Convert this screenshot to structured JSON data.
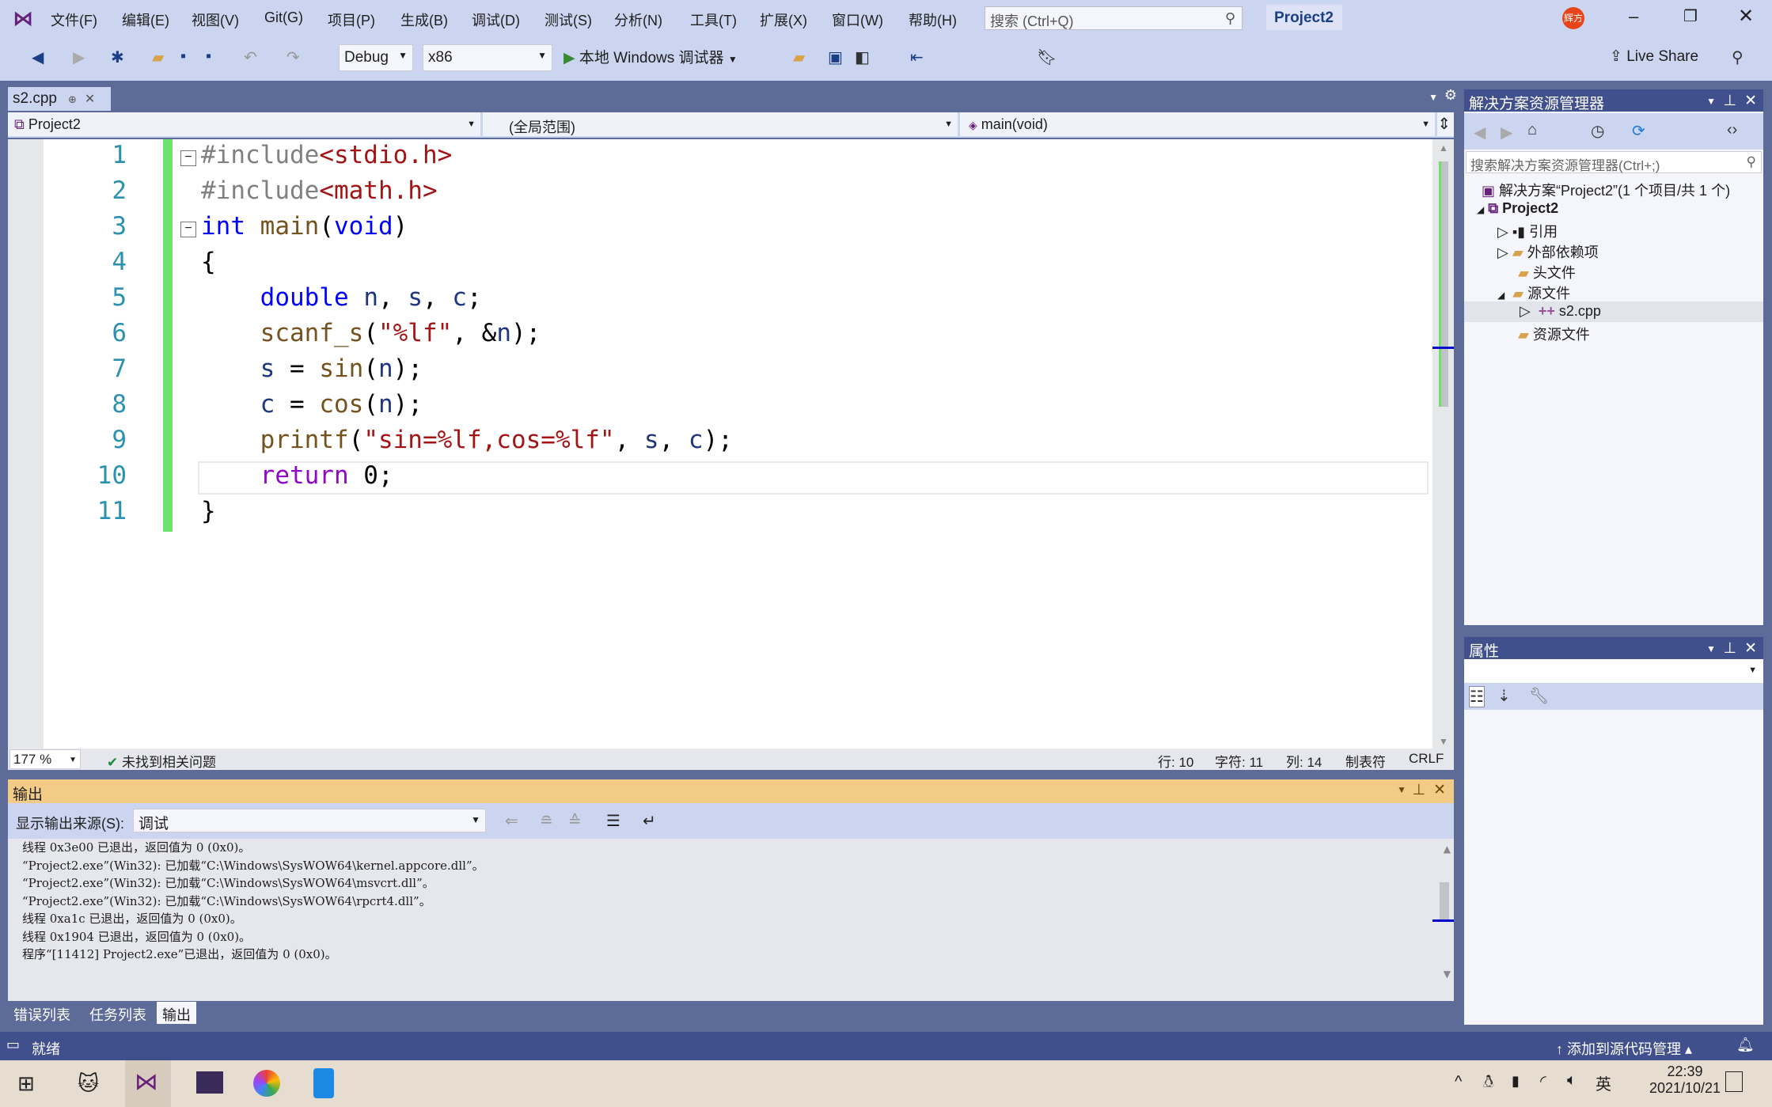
{
  "titlebar": {
    "menus": [
      "文件(F)",
      "编辑(E)",
      "视图(V)",
      "Git(G)",
      "项目(P)",
      "生成(B)",
      "调试(D)",
      "测试(S)",
      "分析(N)",
      "工具(T)",
      "扩展(X)",
      "窗口(W)",
      "帮助(H)"
    ],
    "search_placeholder": "搜索 (Ctrl+Q)",
    "project": "Project2",
    "avatar": "辉方",
    "accent": "#68217a"
  },
  "toolbar": {
    "config": "Debug",
    "platform": "x86",
    "run": "本地 Windows 调试器",
    "live_share": "Live Share"
  },
  "editor": {
    "tab": "s2.cpp",
    "nav_project": "Project2",
    "nav_scope": "(全局范围)",
    "nav_member": "main(void)",
    "lines": [
      [
        [
          "#include",
          "pp"
        ],
        [
          "<stdio.h>",
          "str"
        ]
      ],
      [
        [
          "#include",
          "pp"
        ],
        [
          "<math.h>",
          "str"
        ]
      ],
      [
        [
          "int",
          "kw"
        ],
        [
          " ",
          ""
        ],
        [
          "main",
          "fn"
        ],
        [
          "(",
          ""
        ],
        [
          "void",
          "kw"
        ],
        [
          ")",
          ""
        ]
      ],
      [
        [
          "{",
          ""
        ]
      ],
      [
        [
          "    ",
          ""
        ],
        [
          "double",
          "kw"
        ],
        [
          " ",
          ""
        ],
        [
          "n",
          "var"
        ],
        [
          ", ",
          ""
        ],
        [
          "s",
          "var"
        ],
        [
          ", ",
          ""
        ],
        [
          "c",
          "var"
        ],
        [
          ";",
          ""
        ]
      ],
      [
        [
          "    ",
          ""
        ],
        [
          "scanf_s",
          "fn"
        ],
        [
          "(",
          ""
        ],
        [
          "\"%lf\"",
          "str"
        ],
        [
          ", &",
          ""
        ],
        [
          "n",
          "var"
        ],
        [
          ");",
          ""
        ]
      ],
      [
        [
          "    ",
          ""
        ],
        [
          "s",
          "var"
        ],
        [
          " = ",
          ""
        ],
        [
          "sin",
          "fn"
        ],
        [
          "(",
          ""
        ],
        [
          "n",
          "var"
        ],
        [
          ");",
          ""
        ]
      ],
      [
        [
          "    ",
          ""
        ],
        [
          "c",
          "var"
        ],
        [
          " = ",
          ""
        ],
        [
          "cos",
          "fn"
        ],
        [
          "(",
          ""
        ],
        [
          "n",
          "var"
        ],
        [
          ");",
          ""
        ]
      ],
      [
        [
          "    ",
          ""
        ],
        [
          "printf",
          "fn"
        ],
        [
          "(",
          ""
        ],
        [
          "\"sin=%lf,cos=%lf\"",
          "str"
        ],
        [
          ", ",
          ""
        ],
        [
          "s",
          "var"
        ],
        [
          ", ",
          ""
        ],
        [
          "c",
          "var"
        ],
        [
          ");",
          ""
        ]
      ],
      [
        [
          "    ",
          ""
        ],
        [
          "return",
          "ret"
        ],
        [
          " 0;",
          ""
        ]
      ],
      [
        [
          "}",
          ""
        ]
      ]
    ],
    "zoom": "177 %",
    "issues": "未找到相关问题",
    "row": "行: 10",
    "char": "字符: 11",
    "col": "列: 14",
    "indent": "制表符",
    "eol": "CRLF"
  },
  "output": {
    "title": "输出",
    "source_label": "显示输出来源(S):",
    "source": "调试",
    "lines": [
      "线程 0x3e00 已退出，返回值为 0 (0x0)。",
      "“Project2.exe”(Win32): 已加载“C:\\Windows\\SysWOW64\\kernel.appcore.dll”。",
      "“Project2.exe”(Win32): 已加载“C:\\Windows\\SysWOW64\\msvcrt.dll”。",
      "“Project2.exe”(Win32): 已加载“C:\\Windows\\SysWOW64\\rpcrt4.dll”。",
      "线程 0xa1c 已退出，返回值为 0 (0x0)。",
      "线程 0x1904 已退出，返回值为 0 (0x0)。",
      "程序“[11412] Project2.exe”已退出，返回值为 0 (0x0)。"
    ]
  },
  "bottom_tabs": [
    "错误列表",
    "任务列表",
    "输出"
  ],
  "solution_explorer": {
    "title": "解决方案资源管理器",
    "search_placeholder": "搜索解决方案资源管理器(Ctrl+;)",
    "solution": "解决方案“Project2”(1 个项目/共 1 个)",
    "project": "Project2",
    "items": [
      "引用",
      "外部依赖项",
      "头文件",
      "源文件",
      "s2.cpp",
      "资源文件"
    ]
  },
  "properties": {
    "title": "属性"
  },
  "status": {
    "ready": "就绪",
    "source_control": "添加到源代码管理"
  },
  "taskbar": {
    "ime": "英",
    "time": "22:39",
    "date": "2021/10/21"
  }
}
